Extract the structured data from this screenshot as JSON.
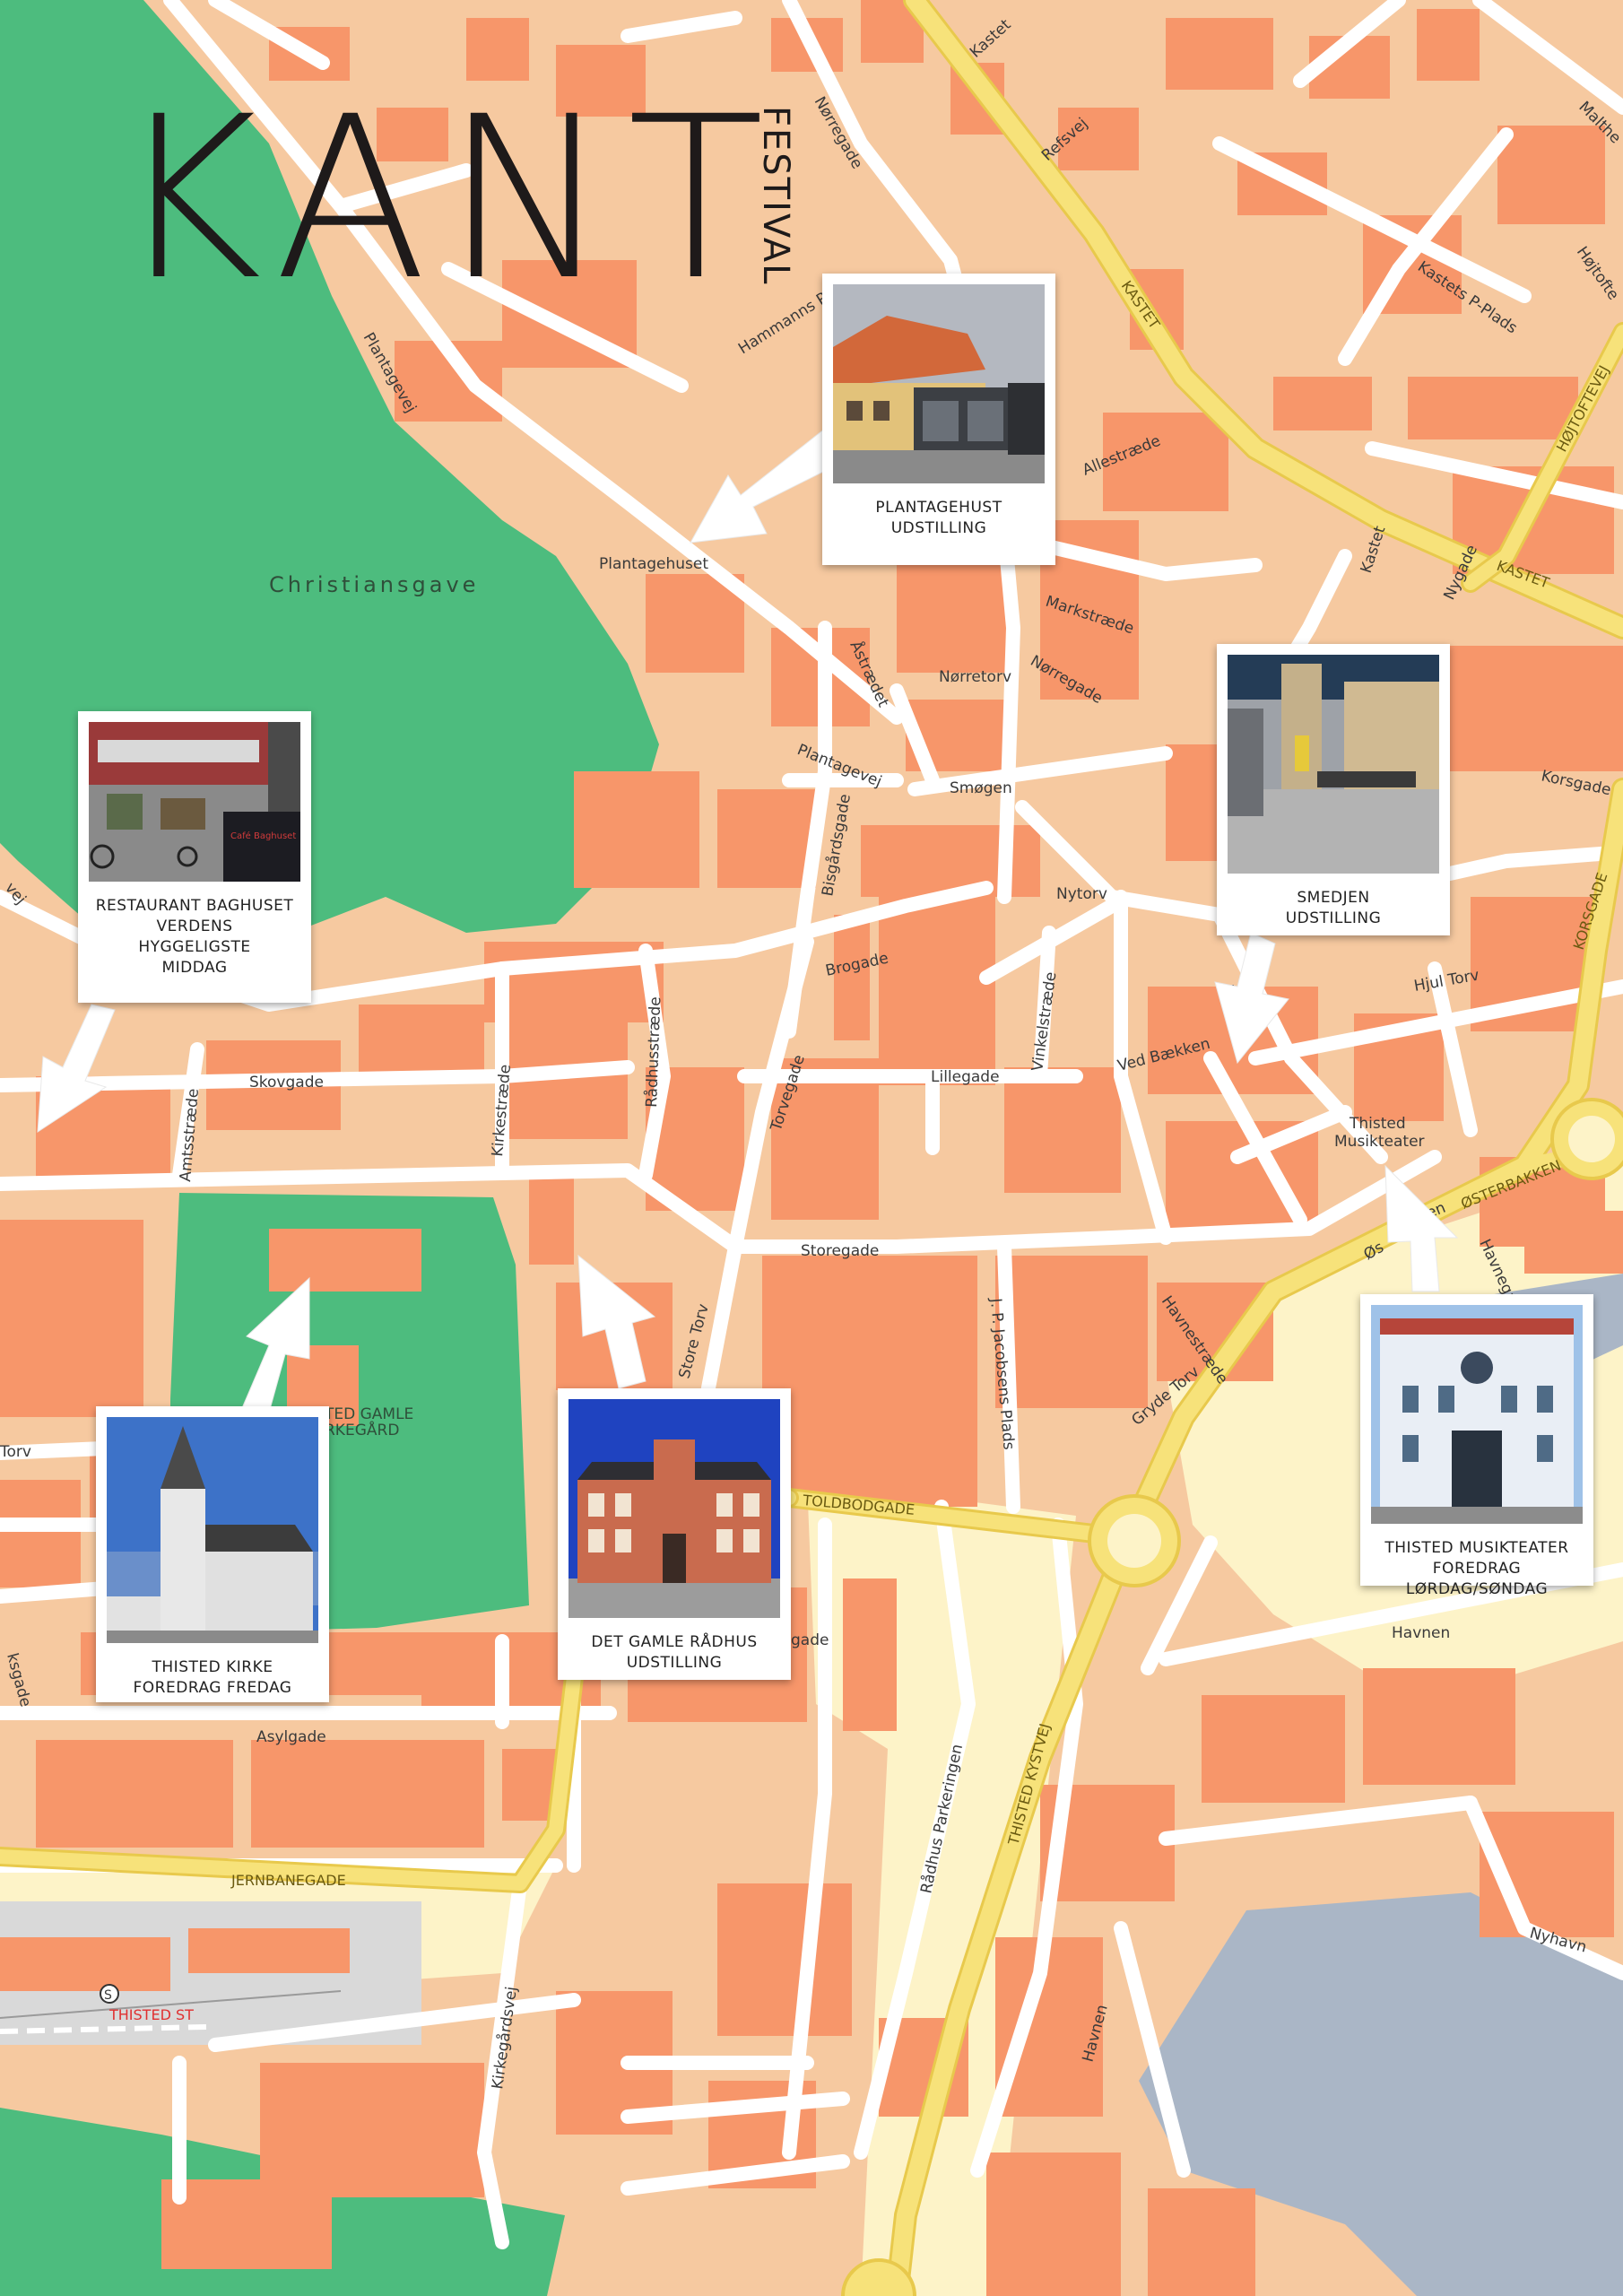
{
  "logo": {
    "main": "KANT",
    "sub": "FESTIVAL"
  },
  "park": {
    "name": "Christiansgave",
    "cemetery": "TED GAMLE\nRKEGÅRD"
  },
  "streets": {
    "kastet": "Kastet",
    "refsvej": "Refsvej",
    "norregade": "Nørregade",
    "hammanns": "Hammanns Pl.",
    "plantagevej": "Plantagevej",
    "plantagehuset": "Plantagehuset",
    "kastet_caps": "KASTET",
    "kastets_p": "Kastets P-Plads",
    "hojtoft": "Højtoftevej",
    "hojtoftevej_caps": "HØJTOFTEVEJ",
    "allestraede": "Allestræde",
    "kastet2": "Kastet",
    "nygade": "Nygade",
    "kastet3": "KASTET",
    "markstraede": "Markstræde",
    "astraedet": "Åstrædet",
    "norretorv": "Nørretorv",
    "norregade2": "Nørregade",
    "plantagevej2": "Plantagevej",
    "smogen": "Smøgen",
    "korsgade": "Korsgade",
    "korsgade_caps": "KORSGADE",
    "bisgaardsgade": "Bisgårdsgade",
    "nytorv": "Nytorv",
    "brogade": "Brogade",
    "storetorv": "Store Torv",
    "hjultorv": "Hjul Torv",
    "vinkelstraede": "Vinkelstræde",
    "raadhusstraede": "Rådhusstræde",
    "skovgade": "Skovgade",
    "lillegade": "Lillegade",
    "vedbaekken": "Ved Bækken",
    "amtsstraede": "Amtsstræde",
    "kirkestraede": "Kirkestræde",
    "torvegade": "Torvegade",
    "thisted_musik": "Thisted\nMusikteater",
    "osterbakken": "ØSTERBAKKEN",
    "storegade": "Storegade",
    "store_torv": "Store Torv",
    "havnestraede": "Havnestræde",
    "havnegade": "Havnegade",
    "jpjacobsens": "J. P. Jacobsens Plads",
    "grydetorv": "Gryde Torv",
    "toldbodgade": "TOLDBODGADE",
    "torv": "Torv",
    "havnen": "Havnen",
    "asylgade": "Asylgade",
    "jernbanegade": "JERNBANEGADE",
    "raadhus_park": "Rådhus Parkeringen",
    "thisted_kystvej": "THISTED KYSTVEJ",
    "kirkegaardsvej": "Kirkegårdsvej",
    "havnen2": "Havnen",
    "nyhavn": "Nyhavn",
    "station": "THISTED ST",
    "stationsymbol": "S",
    "gade": "gade",
    "ksgade": "ksgade",
    "vej": "vej",
    "ken": "ken",
    "stgade": "St",
    "ost": "Øs",
    "maltbe": "Malthe",
    "hojtofte": "Højtofte"
  },
  "venues": [
    {
      "id": "plantagehust",
      "caption": "PLANTAGEHUST\nUDSTILLING"
    },
    {
      "id": "baghuset",
      "caption": "RESTAURANT BAGHUSET\nVERDENS\nHYGGELIGSTE\nMIDDAG"
    },
    {
      "id": "smedjen",
      "caption": "SMEDJEN\nUDSTILLING"
    },
    {
      "id": "kirke",
      "caption": "THISTED KIRKE\nFOREDRAG FREDAG"
    },
    {
      "id": "raadhus",
      "caption": "DET GAMLE RÅDHUS\nUDSTILLING"
    },
    {
      "id": "musikteater",
      "caption": "THISTED MUSIKTEATER\nFOREDRAG LØRDAG/SØNDAG"
    }
  ],
  "photo_text": {
    "cafe_sign": "Café Baghuset"
  },
  "colors": {
    "urban": "#f6c9a0",
    "building": "#f7966a",
    "park": "#4dbc7e",
    "water": "#aab6c6",
    "road": "#ffffff",
    "major_road": "#f7e27a",
    "light_zone": "#fdf3c8",
    "rail": "#d9d9d9"
  }
}
